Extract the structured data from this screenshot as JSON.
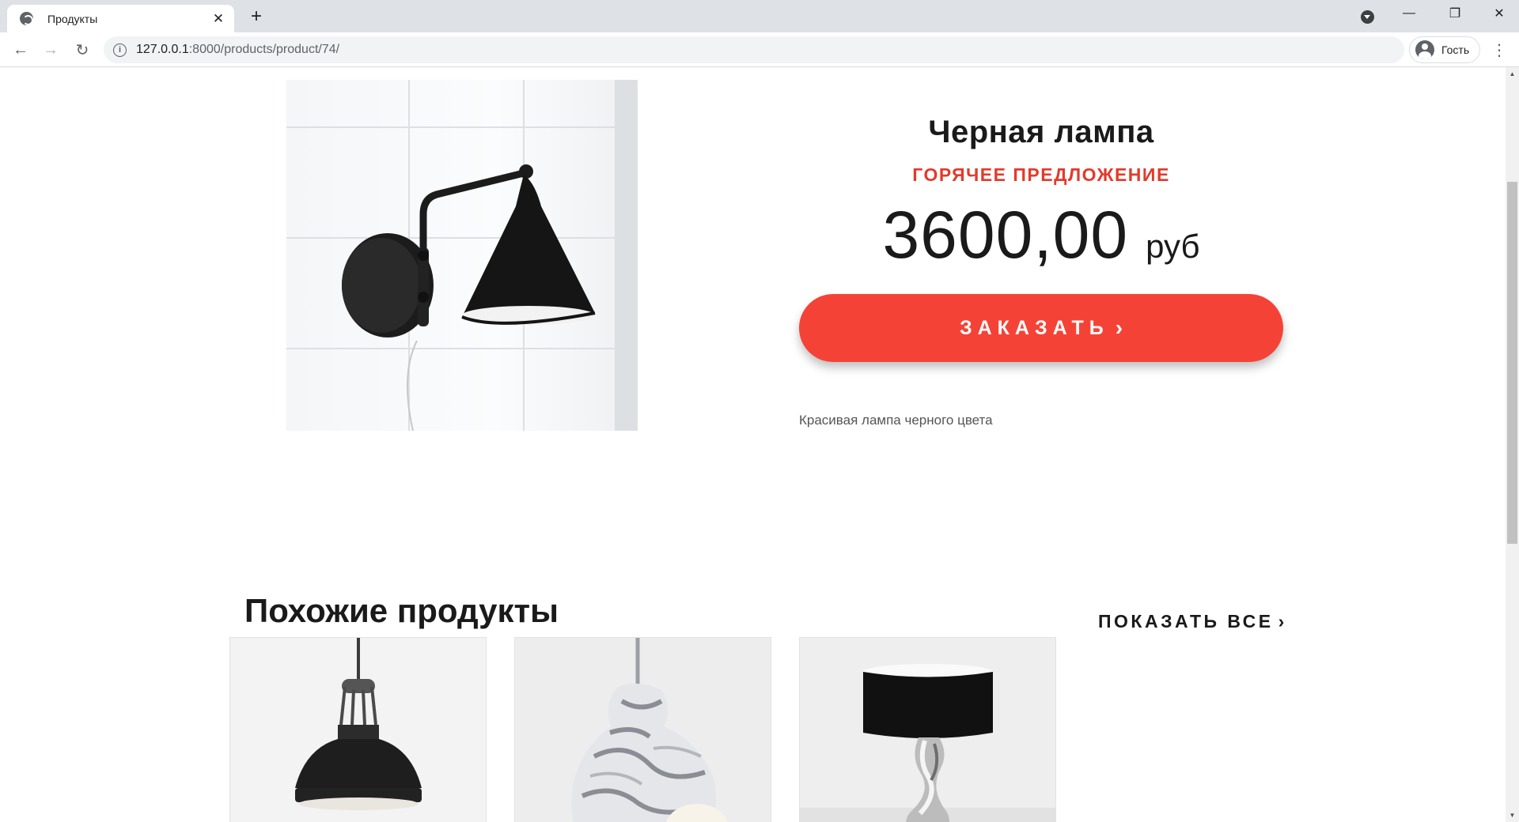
{
  "browser": {
    "tab_title": "Продукты",
    "tab_close": "✕",
    "new_tab": "+",
    "url_host": "127.0.0.1",
    "url_path": ":8000/products/product/74/",
    "profile_name": "Гость",
    "window_controls": {
      "minimize": "—",
      "restore": "❐",
      "close": "✕"
    },
    "nav": {
      "back": "←",
      "forward": "→",
      "reload": "↻",
      "menu": "⋮"
    },
    "icons": [
      "globe-icon",
      "info-icon",
      "profile-icon",
      "tab-search-icon"
    ]
  },
  "product": {
    "name": "Черная лампа",
    "badge": "ГОРЯЧЕЕ ПРЕДЛОЖЕНИЕ",
    "price": "3600,00",
    "currency": "руб",
    "order_label": "ЗАКАЗАТЬ",
    "order_icon": "›",
    "description": "Красивая лампа черного цвета"
  },
  "similar": {
    "title": "Похожие продукты",
    "show_all": "ПОКАЗАТЬ ВСЕ",
    "show_all_icon": "›",
    "items": [
      {
        "image": "pendant-lamp-image"
      },
      {
        "image": "marble-lamp-image"
      },
      {
        "image": "table-lamp-image"
      }
    ]
  },
  "colors": {
    "accent": "#f44336",
    "badge": "#e23a2c",
    "text": "#1a1a1a"
  }
}
